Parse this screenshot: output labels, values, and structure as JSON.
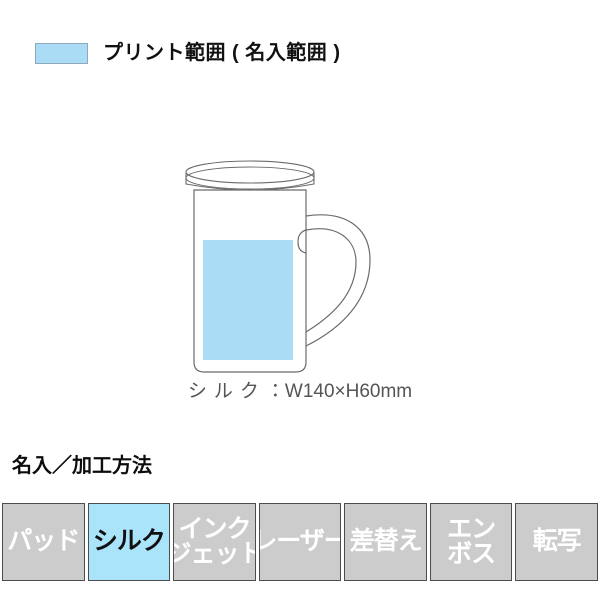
{
  "legend": {
    "swatch_color": "#aadcf6",
    "swatch_border_color": "#8fa9b8",
    "label": "プリント範囲 ( 名入範囲 )",
    "swatch_icon": "print-area-swatch"
  },
  "illustration": {
    "product": "lidded-mug-with-handle",
    "outline_color": "#6b6b6b",
    "print_area_color": "#aadcf6",
    "caption_jp": "シルク",
    "caption_separator": "：",
    "caption_dimensions": "W140×H60mm",
    "caption_full": "シルク：W140×H60mm"
  },
  "methods": {
    "title": "名入／加工方法",
    "active_color": "#aae4fa",
    "inactive_color": "#cccccc",
    "border_color": "#4d4d4d",
    "items": [
      {
        "label": "パッド",
        "lines": [
          "パッド"
        ],
        "active": false
      },
      {
        "label": "シルク",
        "lines": [
          "シルク"
        ],
        "active": true
      },
      {
        "label": "インクジェット",
        "lines": [
          "インク",
          "ジェット"
        ],
        "active": false
      },
      {
        "label": "レーザー",
        "lines": [
          "レーザー"
        ],
        "active": false
      },
      {
        "label": "差替え",
        "lines": [
          "差替え"
        ],
        "active": false
      },
      {
        "label": "エンボス",
        "lines": [
          "エン",
          "ボス"
        ],
        "active": false
      },
      {
        "label": "転写",
        "lines": [
          "転写"
        ],
        "active": false
      }
    ]
  }
}
